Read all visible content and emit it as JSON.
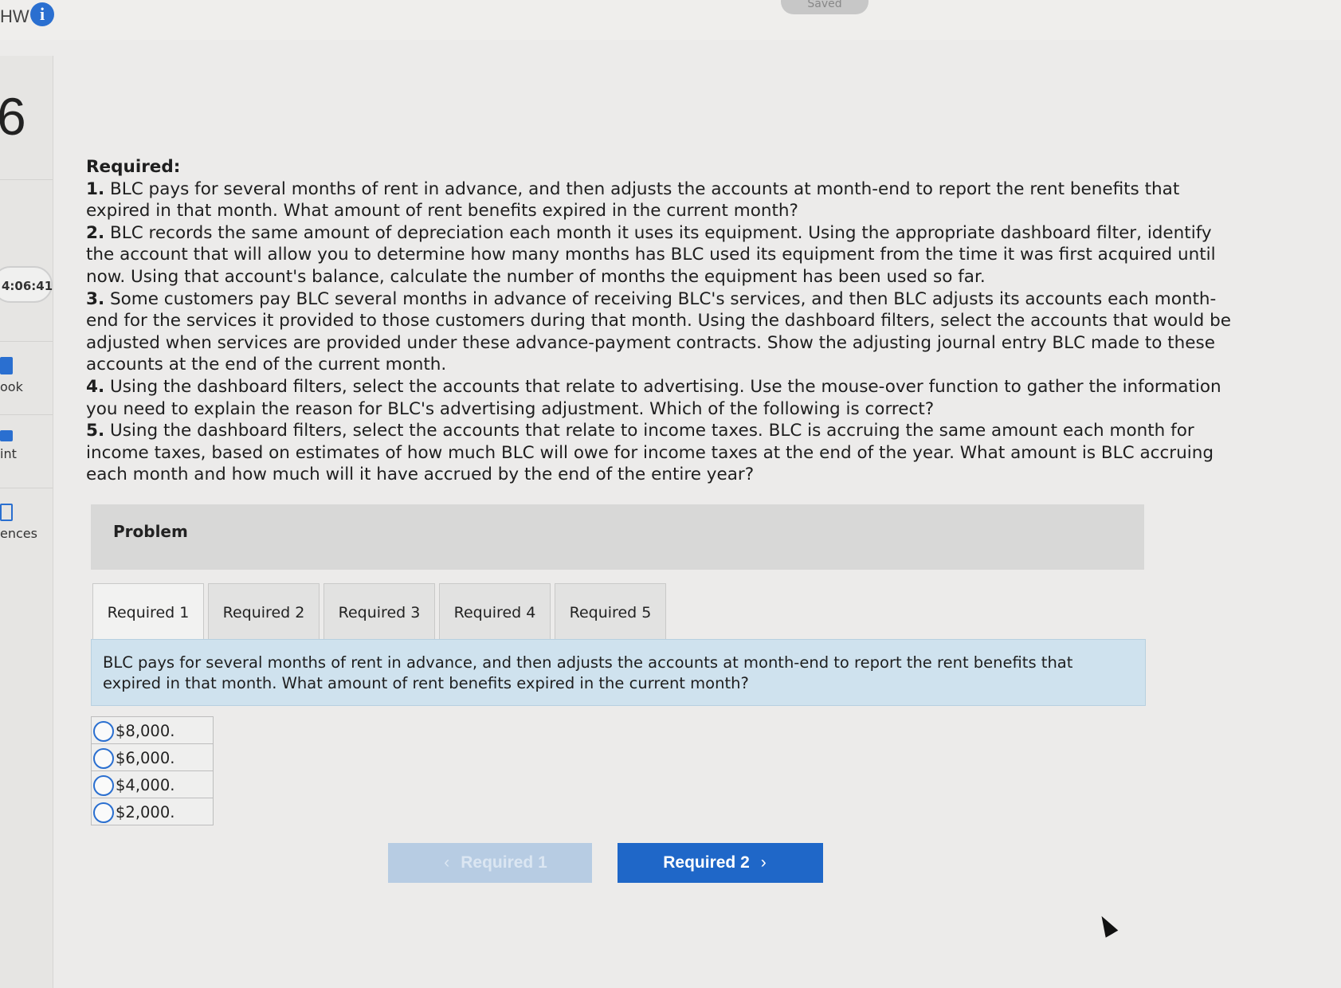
{
  "header": {
    "hw_label": "HW",
    "info_icon": "info-icon",
    "saved_label": "Saved"
  },
  "sidebar": {
    "question_number": "6",
    "timer": "4:06:41",
    "items": [
      {
        "label": "ook",
        "icon": "book-icon"
      },
      {
        "label": "int",
        "icon": "print-icon"
      },
      {
        "label": "ences",
        "icon": "references-icon"
      }
    ]
  },
  "required": {
    "title": "Required:",
    "items": [
      {
        "num": "1.",
        "text": "BLC pays for several months of rent in advance, and then adjusts the accounts at month-end to report the rent benefits that expired in that month. What amount of rent benefits expired in the current month?"
      },
      {
        "num": "2.",
        "text": "BLC records the same amount of depreciation each month it uses its equipment. Using the appropriate dashboard filter, identify the account that will allow you to determine how many months has BLC used its equipment from the time it was first acquired until now. Using that account's balance, calculate the number of months the equipment has been used so far."
      },
      {
        "num": "3.",
        "text": "Some customers pay BLC several months in advance of receiving BLC's services, and then BLC adjusts its accounts each month-end for the services it provided to those customers during that month. Using the dashboard filters, select the accounts that would be adjusted when services are provided under these advance-payment contracts. Show the adjusting journal entry BLC made to these accounts at the end of the current month."
      },
      {
        "num": "4.",
        "text": "Using the dashboard filters, select the accounts that relate to advertising. Use the mouse-over function to gather the information you need to explain the reason for BLC's advertising adjustment. Which of the following is correct?"
      },
      {
        "num": "5.",
        "text": "Using the dashboard filters, select the accounts that relate to income taxes. BLC is accruing the same amount each month for income taxes, based on estimates of how much BLC will owe for income taxes at the end of the year. What amount is BLC accruing each month and how much will it have accrued by the end of the entire year?"
      }
    ]
  },
  "problem": {
    "label": "Problem",
    "tabs": [
      "Required 1",
      "Required 2",
      "Required 3",
      "Required 4",
      "Required 5"
    ],
    "active_tab": 0,
    "question": "BLC pays for several months of rent in advance, and then adjusts the accounts at month-end to report the rent benefits that expired in that month. What amount of rent benefits expired in the current month?",
    "options": [
      "$8,000.",
      "$6,000.",
      "$4,000.",
      "$2,000."
    ]
  },
  "navigation": {
    "prev_label": "Required 1",
    "next_label": "Required 2"
  },
  "colors": {
    "accent": "#1f67c8",
    "question_panel": "#cfe2ee",
    "background": "#ecebea"
  }
}
